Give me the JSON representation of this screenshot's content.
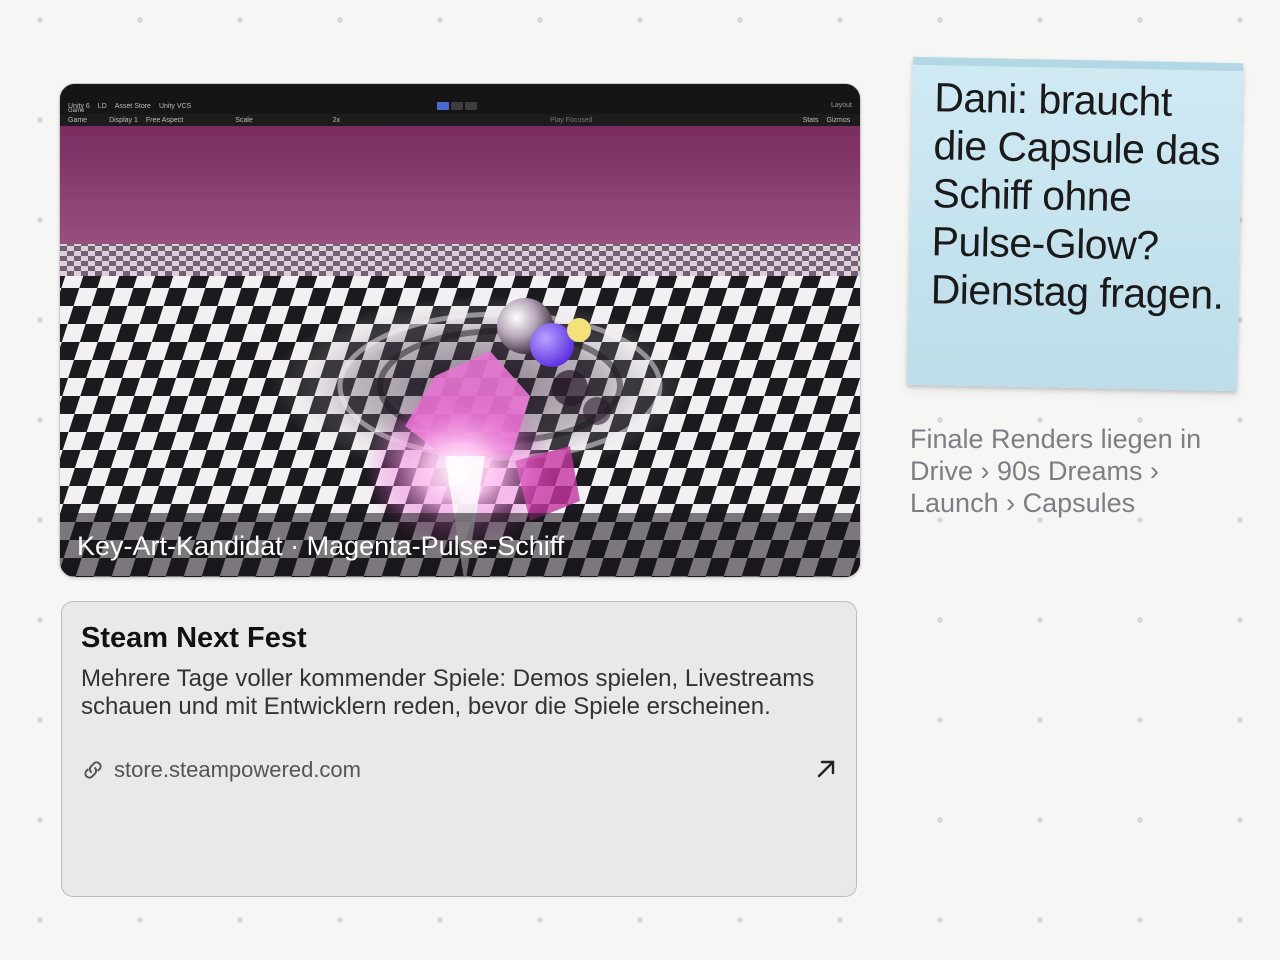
{
  "image_card": {
    "caption": "Key-Art-Kandidat · Magenta-Pulse-Schiff",
    "editor": {
      "account": "Unity 6",
      "ld": "LD",
      "asset_store": "Asset Store",
      "vcs": "Unity VCS",
      "layout": "Layout",
      "panel": "Game",
      "game_dropdown": "Game",
      "display": "Display 1",
      "aspect": "Free Aspect",
      "scale": "Scale",
      "scale_value": "2x",
      "play_focused": "Play Focused",
      "stats": "Stats",
      "gizmos": "Gizmos"
    }
  },
  "link_card": {
    "title": "Steam Next Fest",
    "description": "Mehrere Tage voller kommender Spiele: Demos spielen, Livestreams schauen und mit Entwicklern reden, bevor die Spiele erscheinen.",
    "url": "store.steampowered.com",
    "link_icon": "chain-link-icon",
    "open_icon": "arrow-up-right-icon"
  },
  "sticky_note": {
    "text": "Dani: braucht die Capsule das Schiff ohne Pulse-Glow? Dienstag fragen.",
    "color": "#c8e5f0"
  },
  "path_note": {
    "text": "Finale Renders liegen in Drive › 90s Dreams › Launch › Capsules"
  }
}
